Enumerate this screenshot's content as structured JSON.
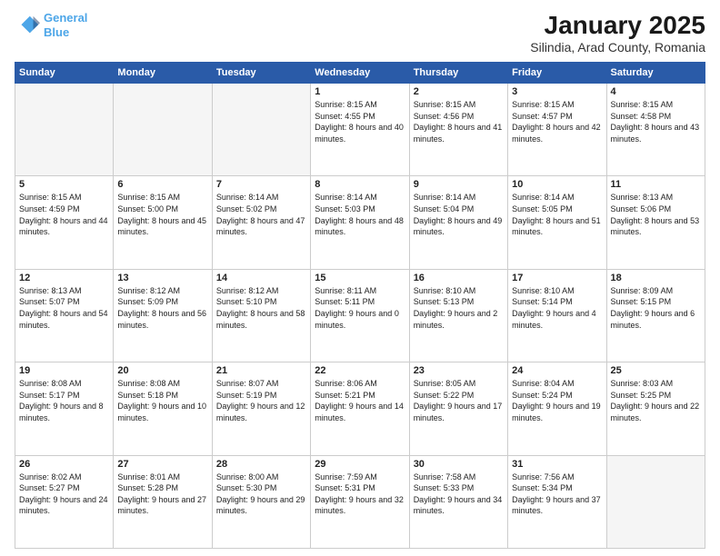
{
  "logo": {
    "line1": "General",
    "line2": "Blue"
  },
  "title": "January 2025",
  "subtitle": "Silindia, Arad County, Romania",
  "weekdays": [
    "Sunday",
    "Monday",
    "Tuesday",
    "Wednesday",
    "Thursday",
    "Friday",
    "Saturday"
  ],
  "weeks": [
    [
      {
        "day": "",
        "sunrise": "",
        "sunset": "",
        "daylight": ""
      },
      {
        "day": "",
        "sunrise": "",
        "sunset": "",
        "daylight": ""
      },
      {
        "day": "",
        "sunrise": "",
        "sunset": "",
        "daylight": ""
      },
      {
        "day": "1",
        "sunrise": "Sunrise: 8:15 AM",
        "sunset": "Sunset: 4:55 PM",
        "daylight": "Daylight: 8 hours and 40 minutes."
      },
      {
        "day": "2",
        "sunrise": "Sunrise: 8:15 AM",
        "sunset": "Sunset: 4:56 PM",
        "daylight": "Daylight: 8 hours and 41 minutes."
      },
      {
        "day": "3",
        "sunrise": "Sunrise: 8:15 AM",
        "sunset": "Sunset: 4:57 PM",
        "daylight": "Daylight: 8 hours and 42 minutes."
      },
      {
        "day": "4",
        "sunrise": "Sunrise: 8:15 AM",
        "sunset": "Sunset: 4:58 PM",
        "daylight": "Daylight: 8 hours and 43 minutes."
      }
    ],
    [
      {
        "day": "5",
        "sunrise": "Sunrise: 8:15 AM",
        "sunset": "Sunset: 4:59 PM",
        "daylight": "Daylight: 8 hours and 44 minutes."
      },
      {
        "day": "6",
        "sunrise": "Sunrise: 8:15 AM",
        "sunset": "Sunset: 5:00 PM",
        "daylight": "Daylight: 8 hours and 45 minutes."
      },
      {
        "day": "7",
        "sunrise": "Sunrise: 8:14 AM",
        "sunset": "Sunset: 5:02 PM",
        "daylight": "Daylight: 8 hours and 47 minutes."
      },
      {
        "day": "8",
        "sunrise": "Sunrise: 8:14 AM",
        "sunset": "Sunset: 5:03 PM",
        "daylight": "Daylight: 8 hours and 48 minutes."
      },
      {
        "day": "9",
        "sunrise": "Sunrise: 8:14 AM",
        "sunset": "Sunset: 5:04 PM",
        "daylight": "Daylight: 8 hours and 49 minutes."
      },
      {
        "day": "10",
        "sunrise": "Sunrise: 8:14 AM",
        "sunset": "Sunset: 5:05 PM",
        "daylight": "Daylight: 8 hours and 51 minutes."
      },
      {
        "day": "11",
        "sunrise": "Sunrise: 8:13 AM",
        "sunset": "Sunset: 5:06 PM",
        "daylight": "Daylight: 8 hours and 53 minutes."
      }
    ],
    [
      {
        "day": "12",
        "sunrise": "Sunrise: 8:13 AM",
        "sunset": "Sunset: 5:07 PM",
        "daylight": "Daylight: 8 hours and 54 minutes."
      },
      {
        "day": "13",
        "sunrise": "Sunrise: 8:12 AM",
        "sunset": "Sunset: 5:09 PM",
        "daylight": "Daylight: 8 hours and 56 minutes."
      },
      {
        "day": "14",
        "sunrise": "Sunrise: 8:12 AM",
        "sunset": "Sunset: 5:10 PM",
        "daylight": "Daylight: 8 hours and 58 minutes."
      },
      {
        "day": "15",
        "sunrise": "Sunrise: 8:11 AM",
        "sunset": "Sunset: 5:11 PM",
        "daylight": "Daylight: 9 hours and 0 minutes."
      },
      {
        "day": "16",
        "sunrise": "Sunrise: 8:10 AM",
        "sunset": "Sunset: 5:13 PM",
        "daylight": "Daylight: 9 hours and 2 minutes."
      },
      {
        "day": "17",
        "sunrise": "Sunrise: 8:10 AM",
        "sunset": "Sunset: 5:14 PM",
        "daylight": "Daylight: 9 hours and 4 minutes."
      },
      {
        "day": "18",
        "sunrise": "Sunrise: 8:09 AM",
        "sunset": "Sunset: 5:15 PM",
        "daylight": "Daylight: 9 hours and 6 minutes."
      }
    ],
    [
      {
        "day": "19",
        "sunrise": "Sunrise: 8:08 AM",
        "sunset": "Sunset: 5:17 PM",
        "daylight": "Daylight: 9 hours and 8 minutes."
      },
      {
        "day": "20",
        "sunrise": "Sunrise: 8:08 AM",
        "sunset": "Sunset: 5:18 PM",
        "daylight": "Daylight: 9 hours and 10 minutes."
      },
      {
        "day": "21",
        "sunrise": "Sunrise: 8:07 AM",
        "sunset": "Sunset: 5:19 PM",
        "daylight": "Daylight: 9 hours and 12 minutes."
      },
      {
        "day": "22",
        "sunrise": "Sunrise: 8:06 AM",
        "sunset": "Sunset: 5:21 PM",
        "daylight": "Daylight: 9 hours and 14 minutes."
      },
      {
        "day": "23",
        "sunrise": "Sunrise: 8:05 AM",
        "sunset": "Sunset: 5:22 PM",
        "daylight": "Daylight: 9 hours and 17 minutes."
      },
      {
        "day": "24",
        "sunrise": "Sunrise: 8:04 AM",
        "sunset": "Sunset: 5:24 PM",
        "daylight": "Daylight: 9 hours and 19 minutes."
      },
      {
        "day": "25",
        "sunrise": "Sunrise: 8:03 AM",
        "sunset": "Sunset: 5:25 PM",
        "daylight": "Daylight: 9 hours and 22 minutes."
      }
    ],
    [
      {
        "day": "26",
        "sunrise": "Sunrise: 8:02 AM",
        "sunset": "Sunset: 5:27 PM",
        "daylight": "Daylight: 9 hours and 24 minutes."
      },
      {
        "day": "27",
        "sunrise": "Sunrise: 8:01 AM",
        "sunset": "Sunset: 5:28 PM",
        "daylight": "Daylight: 9 hours and 27 minutes."
      },
      {
        "day": "28",
        "sunrise": "Sunrise: 8:00 AM",
        "sunset": "Sunset: 5:30 PM",
        "daylight": "Daylight: 9 hours and 29 minutes."
      },
      {
        "day": "29",
        "sunrise": "Sunrise: 7:59 AM",
        "sunset": "Sunset: 5:31 PM",
        "daylight": "Daylight: 9 hours and 32 minutes."
      },
      {
        "day": "30",
        "sunrise": "Sunrise: 7:58 AM",
        "sunset": "Sunset: 5:33 PM",
        "daylight": "Daylight: 9 hours and 34 minutes."
      },
      {
        "day": "31",
        "sunrise": "Sunrise: 7:56 AM",
        "sunset": "Sunset: 5:34 PM",
        "daylight": "Daylight: 9 hours and 37 minutes."
      },
      {
        "day": "",
        "sunrise": "",
        "sunset": "",
        "daylight": ""
      }
    ]
  ]
}
